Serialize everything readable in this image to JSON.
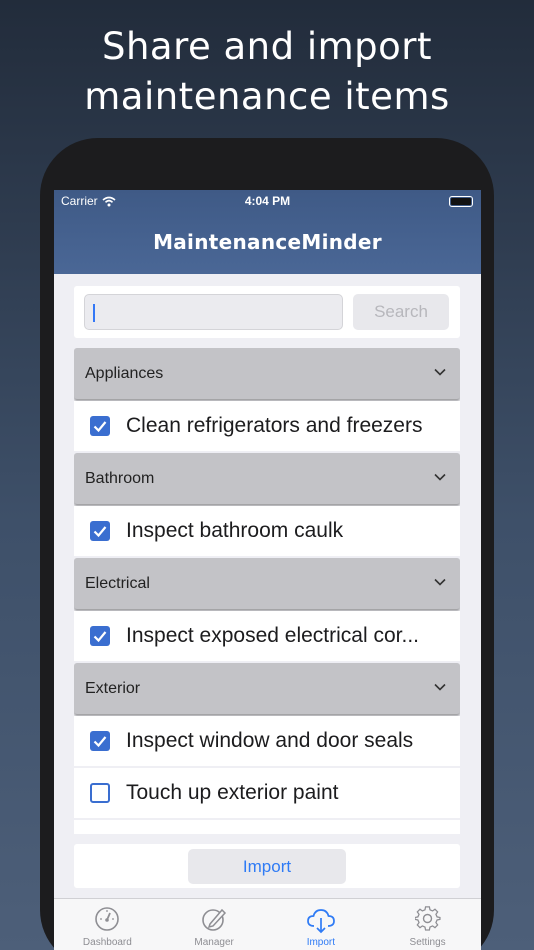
{
  "headline": {
    "line1": "Share and import",
    "line2": "maintenance items"
  },
  "status_bar": {
    "carrier": "Carrier",
    "time": "4:04 PM"
  },
  "nav": {
    "title": "MaintenanceMinder"
  },
  "search": {
    "placeholder": "",
    "value": "",
    "button_label": "Search"
  },
  "sections": [
    {
      "name": "Appliances",
      "items": [
        {
          "label": "Clean refrigerators and freezers",
          "checked": true
        }
      ]
    },
    {
      "name": "Bathroom",
      "items": [
        {
          "label": "Inspect bathroom caulk",
          "checked": true
        }
      ]
    },
    {
      "name": "Electrical",
      "items": [
        {
          "label": "Inspect exposed electrical cor...",
          "checked": true
        }
      ]
    },
    {
      "name": "Exterior",
      "items": [
        {
          "label": "Inspect window and door seals",
          "checked": true
        },
        {
          "label": "Touch up exterior paint",
          "checked": false
        },
        {
          "label": "",
          "checked": false
        }
      ]
    }
  ],
  "import_button": {
    "label": "Import"
  },
  "tabbar": {
    "tabs": [
      {
        "label": "Dashboard",
        "icon": "gauge-icon",
        "active": false
      },
      {
        "label": "Manager",
        "icon": "edit-icon",
        "active": false
      },
      {
        "label": "Import",
        "icon": "cloud-download-icon",
        "active": true
      },
      {
        "label": "Settings",
        "icon": "gear-icon",
        "active": false
      }
    ]
  },
  "colors": {
    "accent": "#2f7bf5",
    "checkbox": "#3a6ed0",
    "navbar": "#4a6796"
  }
}
